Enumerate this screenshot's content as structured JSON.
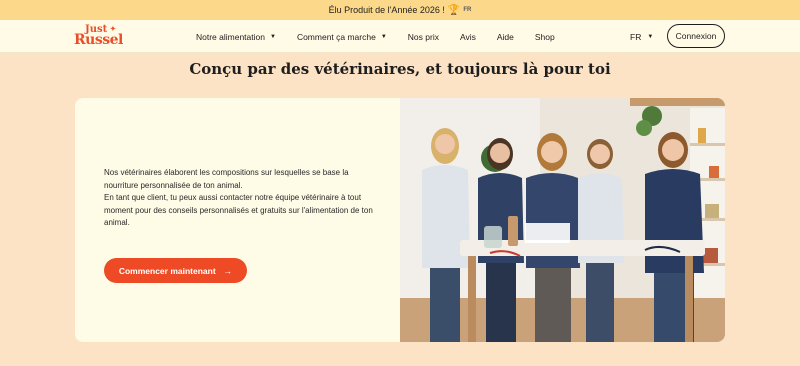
{
  "promo": {
    "text": "Élu Produit de l'Année 2026 !",
    "tag": "FR",
    "icon": "trophy-icon"
  },
  "brand": {
    "line1": "Just",
    "line2": "Russel"
  },
  "nav": {
    "items": [
      {
        "label": "Notre alimentation",
        "dropdown": true
      },
      {
        "label": "Comment ça marche",
        "dropdown": true
      },
      {
        "label": "Nos prix",
        "dropdown": false
      },
      {
        "label": "Avis",
        "dropdown": false
      },
      {
        "label": "Aide",
        "dropdown": false
      },
      {
        "label": "Shop",
        "dropdown": false
      }
    ],
    "language": "FR",
    "login_label": "Connexion"
  },
  "section": {
    "title": "Conçu par des vétérinaires, et toujours là pour toi",
    "paragraph1": "Nos vétérinaires élaborent les compositions sur lesquelles se base la nourriture personnalisée de ton animal.",
    "paragraph2": "En tant que client, tu peux aussi contacter notre équipe vétérinaire à tout moment pour des conseils personnalisés et gratuits sur l'alimentation de ton animal.",
    "cta_label": "Commencer maintenant",
    "cta_arrow": "→"
  },
  "colors": {
    "accent": "#ee4a25",
    "promo_bg": "#fcd98a",
    "page_bg": "#fde3c6",
    "card_bg": "#fefbe6"
  }
}
